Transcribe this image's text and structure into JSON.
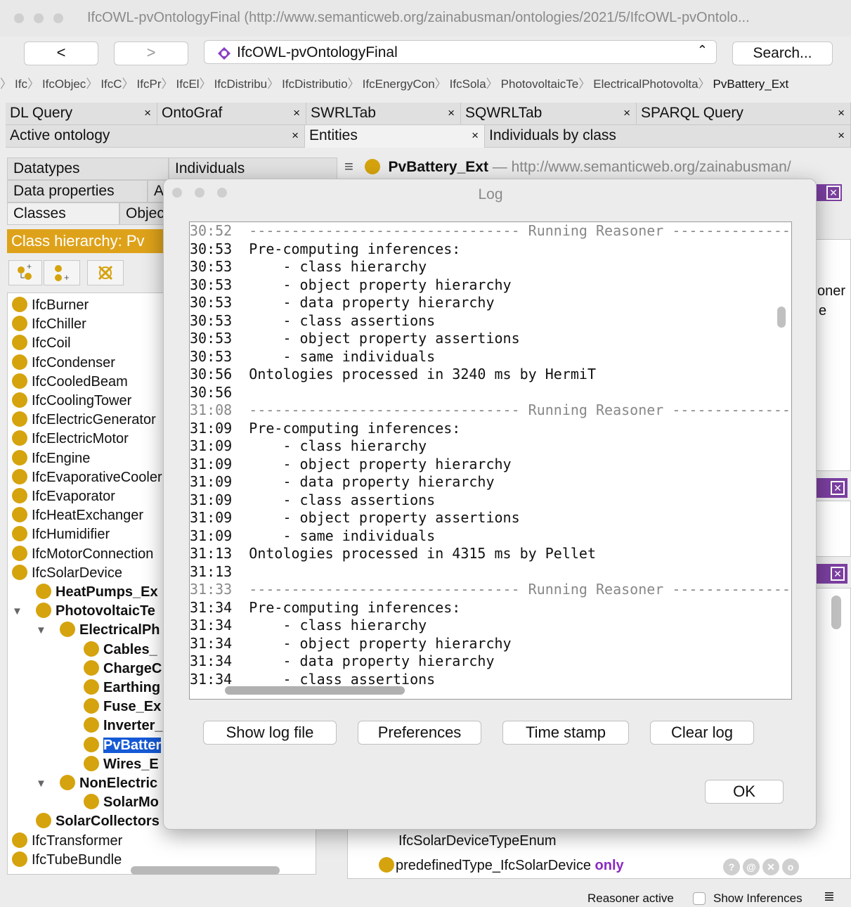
{
  "window": {
    "title": "IfcOWL-pvOntologyFinal (http://www.semanticweb.org/zainabusman/ontologies/2021/5/IfcOWL-pvOntolo..."
  },
  "toolbar": {
    "back": "<",
    "forward": ">",
    "ontology": "IfcOWL-pvOntologyFinal",
    "search": "Search..."
  },
  "breadcrumb": [
    "Ifc",
    "IfcObjec",
    "IfcC",
    "IfcPr",
    "IfcEl",
    "IfcDistribu",
    "IfcDistributio",
    "IfcEnergyCon",
    "IfcSola",
    "PhotovoltaicTe",
    "ElectricalPhotovolta",
    "PvBattery_Ext"
  ],
  "tabs1": [
    "DL Query",
    "OntoGraf",
    "SWRLTab",
    "SQWRLTab",
    "SPARQL Query"
  ],
  "tabs2": [
    "Active ontology",
    "Entities",
    "Individuals by class"
  ],
  "close": "×",
  "left": {
    "datatypes": "Datatypes",
    "individuals": "Individuals",
    "dataprops": "Data properties",
    "a": "A",
    "classes": "Classes",
    "objects": "Objec",
    "hierarchy": "Class hierarchy: Pv"
  },
  "tree": [
    "IfcBurner",
    "IfcChiller",
    "IfcCoil",
    "IfcCondenser",
    "IfcCooledBeam",
    "IfcCoolingTower",
    "IfcElectricGenerator",
    "IfcElectricMotor",
    "IfcEngine",
    "IfcEvaporativeCooler",
    "IfcEvaporator",
    "IfcHeatExchanger",
    "IfcHumidifier",
    "IfcMotorConnection",
    "IfcSolarDevice",
    "HeatPumps_Ex",
    "PhotovoltaicTe",
    "ElectricalPh",
    "Cables_",
    "ChargeC",
    "Earthing",
    "Fuse_Ex",
    "Inverter_",
    "PvBatter",
    "Wires_E",
    "NonElectric",
    "SolarMo",
    "SolarCollectors",
    "IfcTransformer",
    "IfcTubeBundle"
  ],
  "entity": {
    "name": "PvBattery_Ext",
    "dash": "—",
    "iri": "http://www.semanticweb.org/zainabusman/"
  },
  "right": {
    "frag1": "oner",
    "frag2": "e",
    "enum": "IfcSolarDeviceTypeEnum",
    "prop": "predefinedType_IfcSolarDevice",
    "only": "only"
  },
  "status": {
    "reasoner": "Reasoner active",
    "inferences": "Show Inferences"
  },
  "log": {
    "title": "Log",
    "lines": [
      [
        "30:52",
        "-------------------------------- Running Reasoner ------------------"
      ],
      [
        "30:53",
        "Pre-computing inferences:"
      ],
      [
        "30:53",
        "    - class hierarchy"
      ],
      [
        "30:53",
        "    - object property hierarchy"
      ],
      [
        "30:53",
        "    - data property hierarchy"
      ],
      [
        "30:53",
        "    - class assertions"
      ],
      [
        "30:53",
        "    - object property assertions"
      ],
      [
        "30:53",
        "    - same individuals"
      ],
      [
        "30:56",
        "Ontologies processed in 3240 ms by HermiT"
      ],
      [
        "30:56",
        ""
      ],
      [
        "31:08",
        "-------------------------------- Running Reasoner ------------------"
      ],
      [
        "31:09",
        "Pre-computing inferences:"
      ],
      [
        "31:09",
        "    - class hierarchy"
      ],
      [
        "31:09",
        "    - object property hierarchy"
      ],
      [
        "31:09",
        "    - data property hierarchy"
      ],
      [
        "31:09",
        "    - class assertions"
      ],
      [
        "31:09",
        "    - object property assertions"
      ],
      [
        "31:09",
        "    - same individuals"
      ],
      [
        "31:13",
        "Ontologies processed in 4315 ms by Pellet"
      ],
      [
        "31:13",
        ""
      ],
      [
        "31:33",
        "-------------------------------- Running Reasoner ------------------"
      ],
      [
        "31:34",
        "Pre-computing inferences:"
      ],
      [
        "31:34",
        "    - class hierarchy"
      ],
      [
        "31:34",
        "    - object property hierarchy"
      ],
      [
        "31:34",
        "    - data property hierarchy"
      ],
      [
        "31:34",
        "    - class assertions"
      ]
    ],
    "buttons": {
      "showlog": "Show log file",
      "prefs": "Preferences",
      "timestamp": "Time stamp",
      "clear": "Clear log",
      "ok": "OK"
    }
  }
}
